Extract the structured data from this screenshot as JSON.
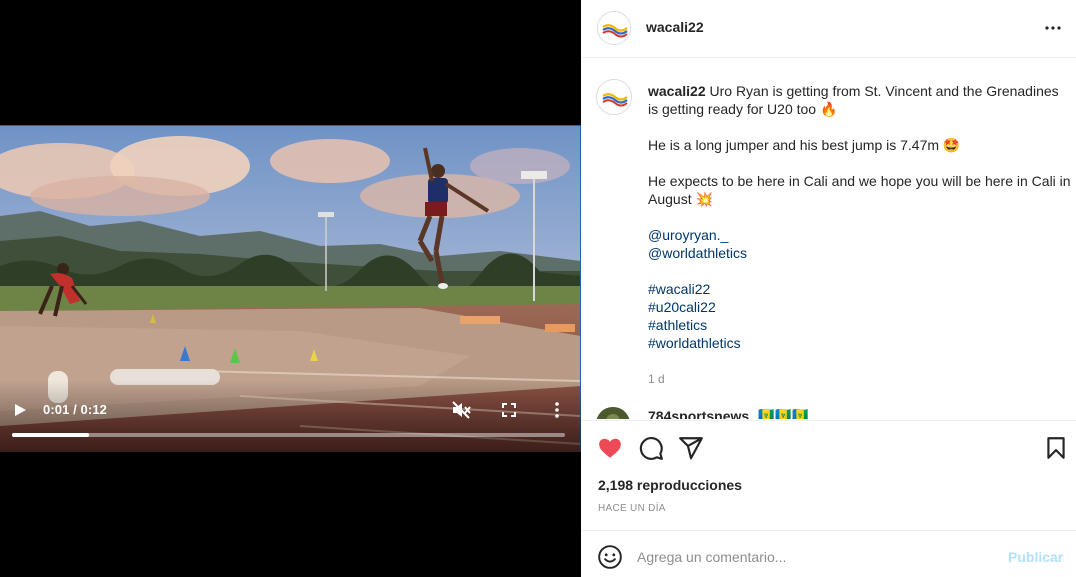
{
  "video": {
    "time_display": "0:01 / 0:12",
    "progress_fraction": 0.14,
    "icons": [
      "play-icon",
      "muted-icon",
      "fullscreen-icon",
      "more-vertical-icon"
    ]
  },
  "header": {
    "username": "wacali22",
    "more_icon": "more-horizontal-icon"
  },
  "caption": {
    "username": "wacali22",
    "text_line1": " Uro Ryan is getting from St. Vincent and the Grenadines is getting ready for U20 too 🔥",
    "text_line2": "He is a long jumper and his best jump is 7.47m 🤩",
    "text_line3": "He expects to be here in Cali and we hope you will be here in Cali in August 💥",
    "mentions": [
      "@uroyryan._",
      "@worldathletics"
    ],
    "hashtags": [
      "#wacali22",
      "#u20cali22",
      "#athletics",
      "#worldathletics"
    ],
    "age": "1 d"
  },
  "comment2": {
    "username": "784sportsnews",
    "flags": "🇻🇨🇻🇨🇻🇨"
  },
  "actions": {
    "views": "2,198 reproducciones",
    "posted_ago": "HACE UN DÍA",
    "icons": [
      "heart-filled-icon",
      "comment-icon",
      "share-icon",
      "bookmark-icon"
    ],
    "like_color": "#ed4956"
  },
  "add_comment": {
    "placeholder": "Agrega un comentario...",
    "publish_label": "Publicar",
    "publish_color": "#b2dffc"
  }
}
